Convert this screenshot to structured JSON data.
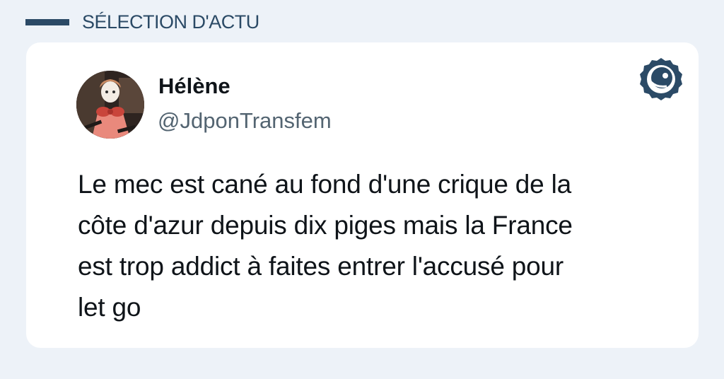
{
  "header": {
    "section_label": "SÉLECTION D'ACTU"
  },
  "tweet": {
    "author_name": "Hélène",
    "author_handle": "@JdponTransfem",
    "text": "Le mec est cané au fond d'une crique de la\ncôte d'azur depuis dix piges mais la France\nest trop addict à faites entrer l'accusé pour\nlet go"
  },
  "icons": {
    "brand": "brand-logo-icon",
    "avatar": "avatar-image"
  },
  "colors": {
    "background": "#edf2f8",
    "accent": "#2b4a66",
    "card": "#ffffff",
    "text_primary": "#0f1419",
    "text_secondary": "#536471"
  }
}
